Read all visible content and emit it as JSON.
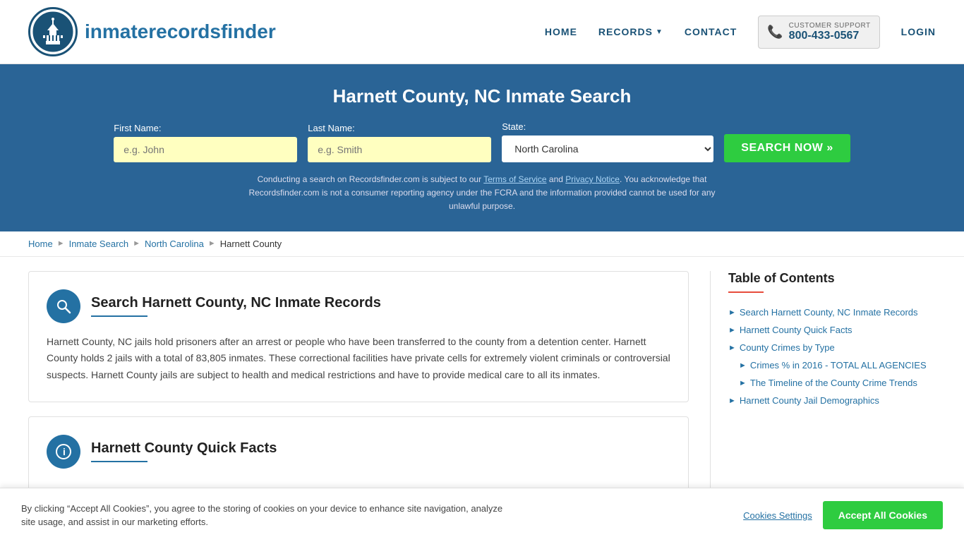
{
  "header": {
    "logo_text_light": "inmaterecords",
    "logo_text_bold": "finder",
    "nav": {
      "home": "HOME",
      "records": "RECORDS",
      "contact": "CONTACT",
      "login": "LOGIN",
      "support_label": "CUSTOMER SUPPORT",
      "support_phone": "800-433-0567"
    }
  },
  "hero": {
    "title": "Harnett County, NC Inmate Search",
    "first_name_label": "First Name:",
    "first_name_placeholder": "e.g. John",
    "last_name_label": "Last Name:",
    "last_name_placeholder": "e.g. Smith",
    "state_label": "State:",
    "state_value": "North Carolina",
    "search_button": "SEARCH NOW »",
    "disclaimer": "Conducting a search on Recordsfinder.com is subject to our Terms of Service and Privacy Notice. You acknowledge that Recordsfinder.com is not a consumer reporting agency under the FCRA and the information provided cannot be used for any unlawful purpose."
  },
  "breadcrumb": {
    "home": "Home",
    "inmate_search": "Inmate Search",
    "north_carolina": "North Carolina",
    "harnett_county": "Harnett County"
  },
  "main": {
    "section1": {
      "title": "Search Harnett County, NC Inmate Records",
      "text": "Harnett County, NC jails hold prisoners after an arrest or people who have been transferred to the county from a detention center. Harnett County holds 2 jails with a total of 83,805 inmates. These correctional facilities have private cells for extremely violent criminals or controversial suspects. Harnett County jails are subject to health and medical restrictions and have to provide medical care to all its inmates."
    },
    "section2": {
      "title": "Harnett County Quick Facts"
    }
  },
  "toc": {
    "title": "Table of Contents",
    "items": [
      {
        "label": "Search Harnett County, NC Inmate Records",
        "sub": false
      },
      {
        "label": "Harnett County Quick Facts",
        "sub": false
      },
      {
        "label": "County Crimes by Type",
        "sub": false
      },
      {
        "label": "Crimes % in 2016 - TOTAL ALL AGENCIES",
        "sub": true
      },
      {
        "label": "The Timeline of the County Crime Trends",
        "sub": true
      },
      {
        "label": "Harnett County Jail Demographics",
        "sub": false
      }
    ]
  },
  "cookie": {
    "text": "By clicking “Accept All Cookies”, you agree to the storing of cookies on your device to enhance site navigation, analyze site usage, and assist in our marketing efforts.",
    "settings_label": "Cookies Settings",
    "accept_label": "Accept All Cookies"
  }
}
